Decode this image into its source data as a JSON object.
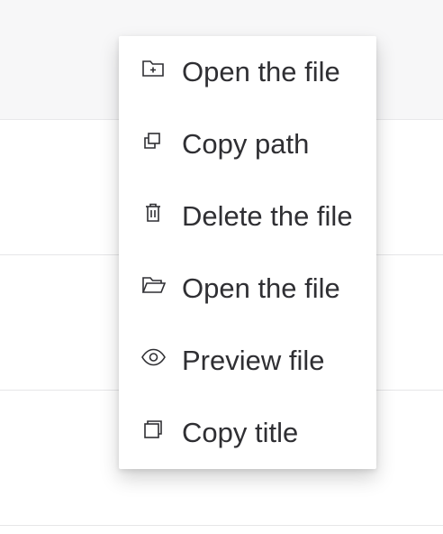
{
  "context_menu": {
    "items": [
      {
        "label": "Open the file",
        "icon": "folder-plus-icon"
      },
      {
        "label": "Copy path",
        "icon": "copy-icon"
      },
      {
        "label": "Delete the file",
        "icon": "trash-icon"
      },
      {
        "label": "Open the file",
        "icon": "folder-open-icon"
      },
      {
        "label": "Preview file",
        "icon": "eye-icon"
      },
      {
        "label": "Copy title",
        "icon": "copy-window-icon"
      }
    ]
  }
}
